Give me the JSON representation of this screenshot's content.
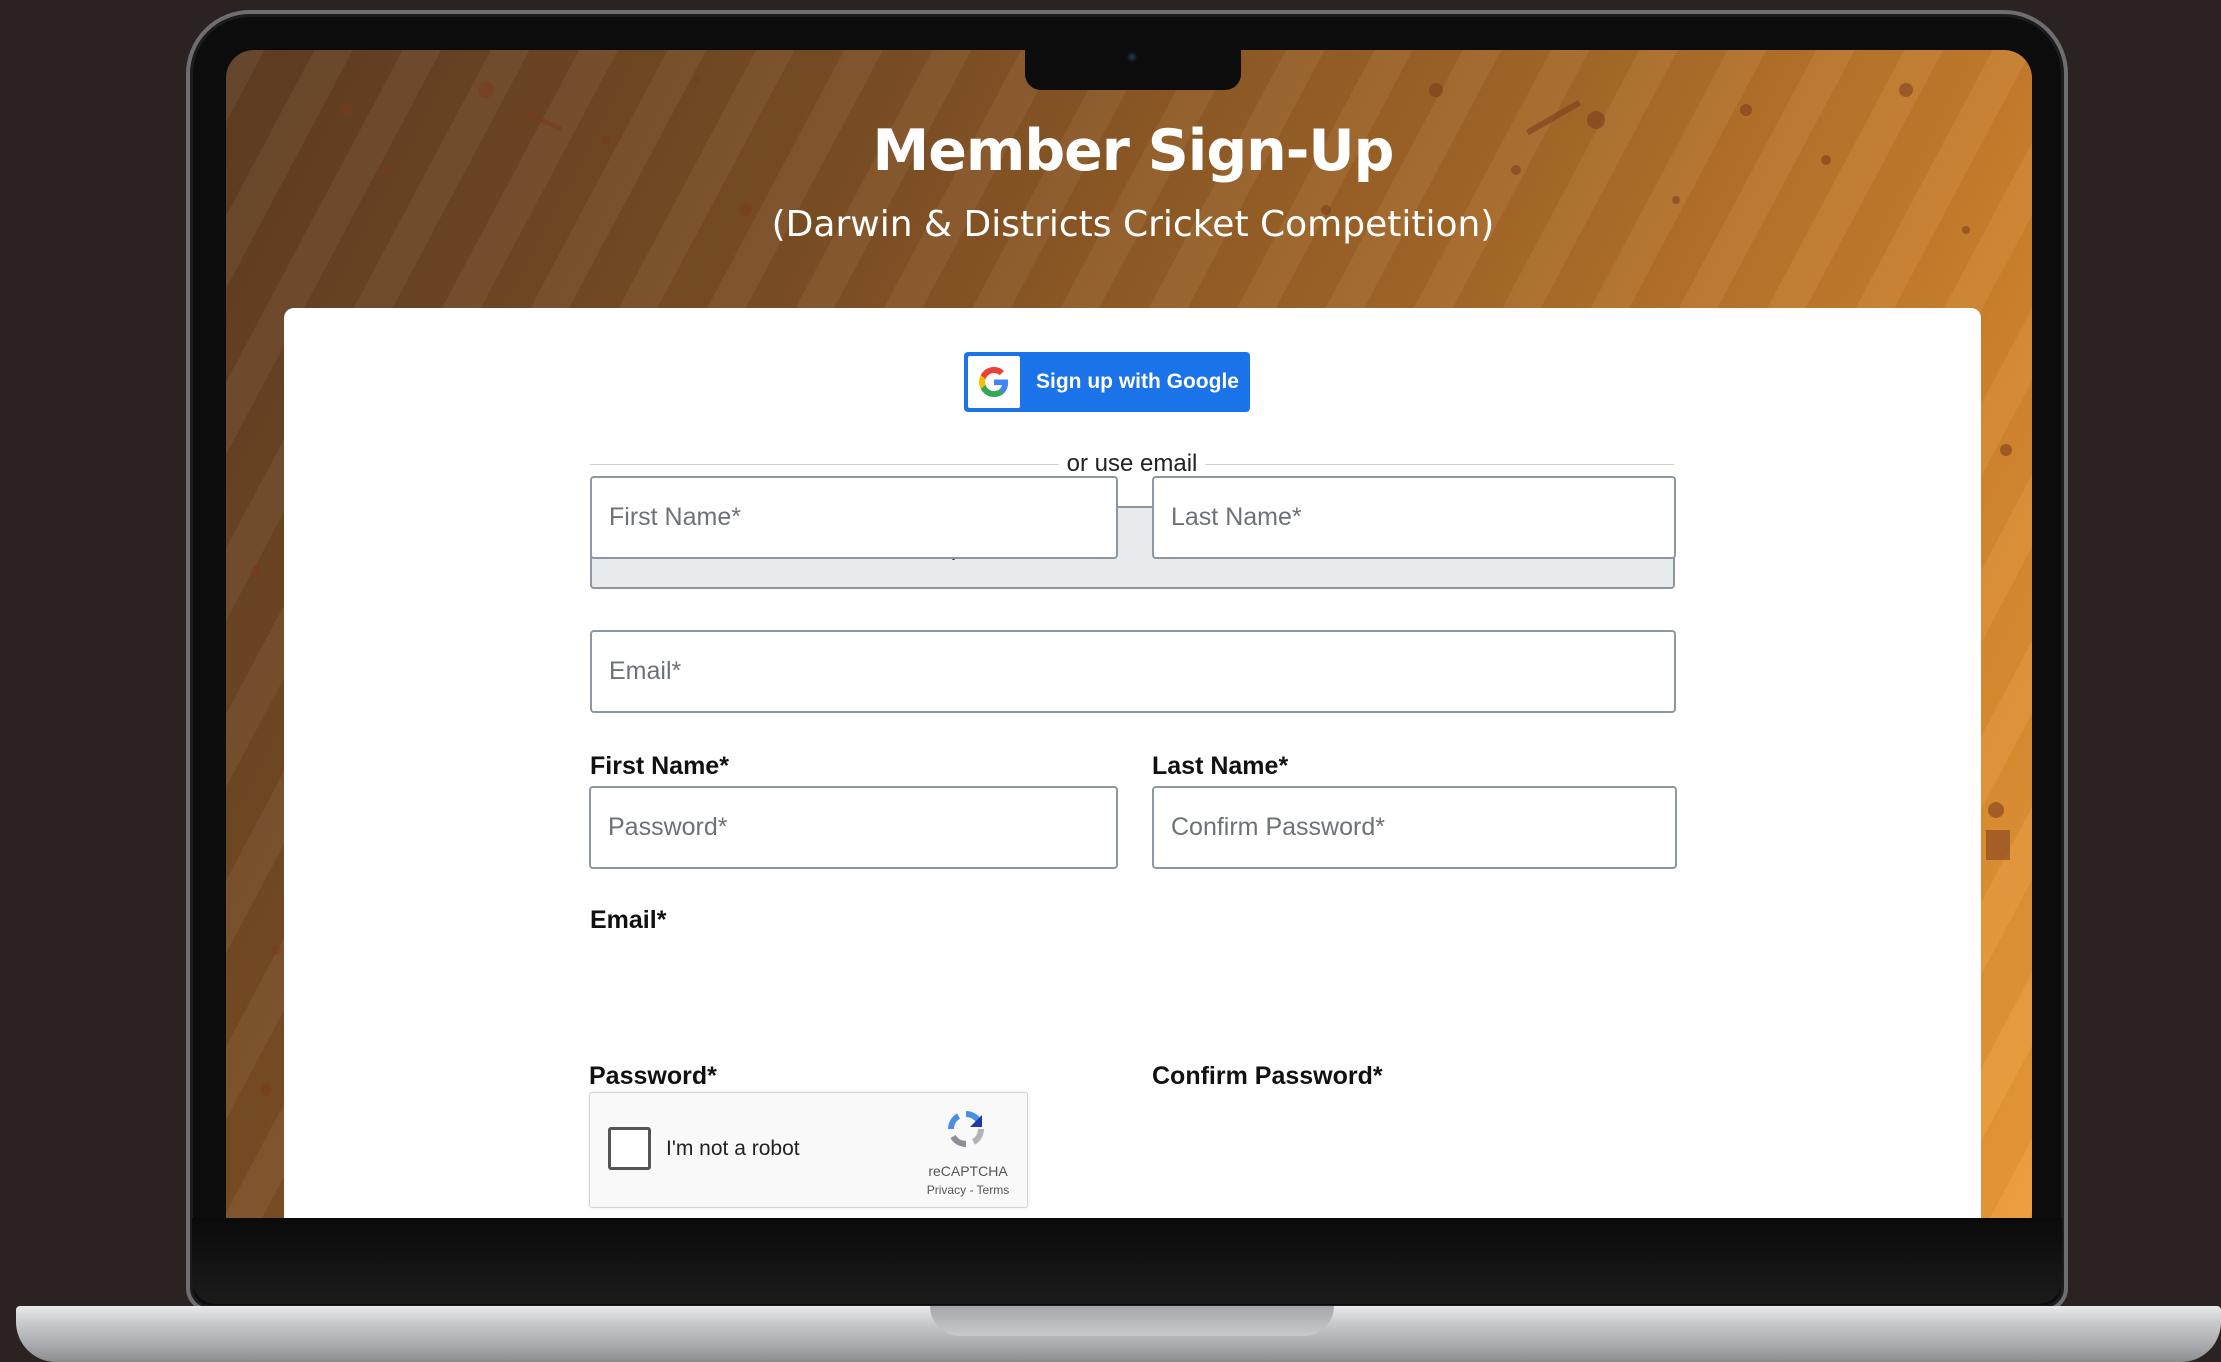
{
  "header": {
    "title": "Member Sign-Up",
    "subtitle": "(Darwin & Districts Cricket Competition)"
  },
  "google_signup": {
    "label": "Sign up with Google",
    "icon": "google-logo-icon"
  },
  "divider_text": "or use email",
  "competition_field": {
    "value": "Darwin & Districts Cricket Competition"
  },
  "fields": {
    "first_name": {
      "label": "First Name*",
      "placeholder": "First Name*"
    },
    "last_name": {
      "label": "Last Name*",
      "placeholder": "Last Name*"
    },
    "email": {
      "label": "Email*",
      "placeholder": "Email*"
    },
    "password": {
      "label": "Password*",
      "placeholder": "Password*"
    },
    "confirm_password": {
      "label": "Confirm Password*",
      "placeholder": "Confirm Password*"
    }
  },
  "recaptcha": {
    "label": "I'm not a robot",
    "brand": "reCAPTCHA",
    "links": "Privacy - Terms",
    "icon": "recaptcha-logo-icon"
  },
  "colors": {
    "google_button": "#1a73e8",
    "background_gradient_start": "#5e3d23",
    "background_gradient_end": "#ec9a38",
    "page_background": "#2b2322"
  }
}
